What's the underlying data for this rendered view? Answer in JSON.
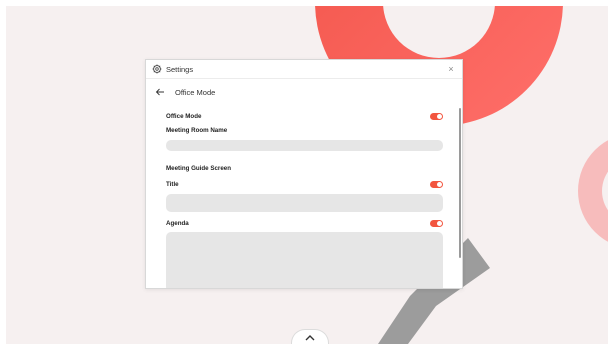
{
  "dialog": {
    "title": "Settings",
    "close_symbol": "×",
    "page_title": "Office Mode"
  },
  "settings": {
    "office_mode_label": "Office Mode",
    "office_mode_on": true,
    "meeting_room_name_label": "Meeting Room Name",
    "meeting_room_name_value": "",
    "meeting_guide_screen_label": "Meeting Guide Screen",
    "title_label": "Title",
    "title_on": true,
    "title_value": "",
    "agenda_label": "Agenda",
    "agenda_on": true,
    "agenda_value": ""
  },
  "icons": {
    "settings": "gear-icon",
    "back": "arrow-left-icon",
    "close": "close-icon",
    "handle": "chevron-up-icon"
  },
  "colors": {
    "accent": "#f2553f",
    "background": "#f6f0f0",
    "field": "#e6e6e6"
  }
}
